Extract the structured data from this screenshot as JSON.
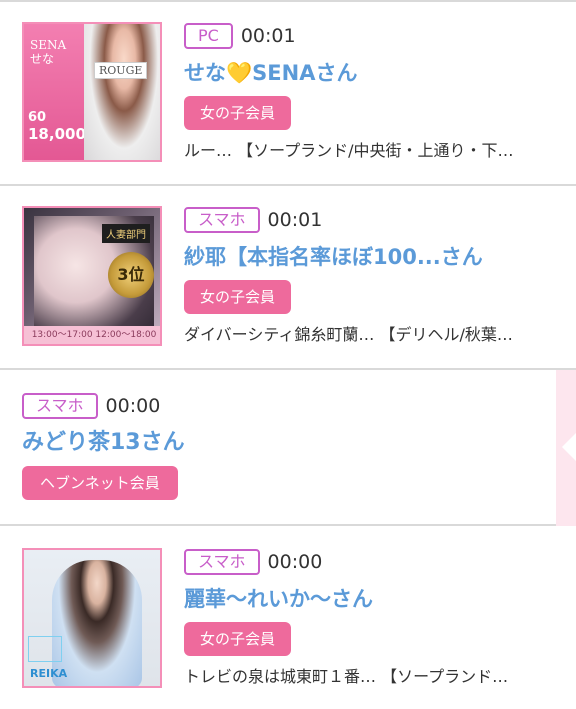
{
  "entries": [
    {
      "device": "PC",
      "time": "00:01",
      "name": "せな💛SENAさん",
      "member_type": "女の子会員",
      "shop": "ルー… 【ソープランド/中央街・上通り・下…",
      "thumb_text": {
        "brand": "SENA",
        "sub": "せな",
        "logo": "ROUGE",
        "minutes": "60",
        "price": "18,000"
      }
    },
    {
      "device": "スマホ",
      "time": "00:01",
      "name": "紗耶【本指名率ほぼ100...さん",
      "member_type": "女の子会員",
      "shop": "ダイバーシティ錦糸町蘭… 【デリヘル/秋葉…",
      "thumb_text": {
        "ribbon": "人妻部門",
        "rank": "3位",
        "hours": "13:00〜17:00  12:00〜18:00"
      }
    },
    {
      "device": "スマホ",
      "time": "00:00",
      "name": "みどり茶13さん",
      "member_type": "ヘブンネット会員"
    },
    {
      "device": "スマホ",
      "time": "00:00",
      "name": "麗華〜れいか〜さん",
      "member_type": "女の子会員",
      "shop": "トレビの泉は城東町１番… 【ソープランド…",
      "thumb_text": {
        "tag": "REIKA"
      }
    }
  ],
  "colors": {
    "device_badge": "#c85ec9",
    "name": "#5b9ad8",
    "member_badge": "#ee6a9c",
    "side_tab": "#fde6ee"
  },
  "icons": {
    "side_tab": "chevron-left-icon"
  }
}
